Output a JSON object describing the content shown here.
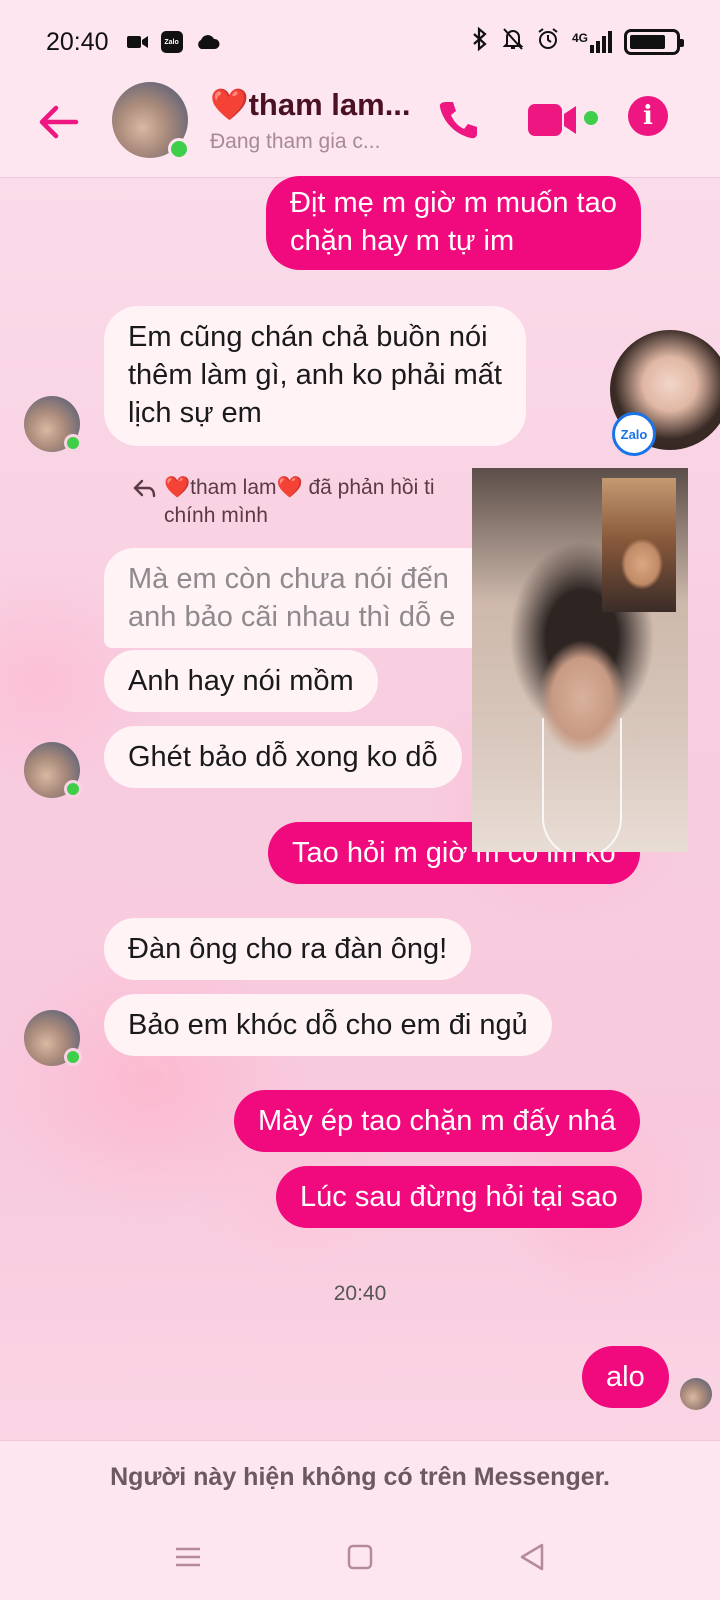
{
  "status_bar": {
    "time": "20:40",
    "left_icons": [
      "video-camera-icon",
      "zalo-icon",
      "cloud-icon"
    ],
    "right_icons": [
      "bluetooth-icon",
      "mute-bell-icon",
      "alarm-icon",
      "signal-4g-icon",
      "battery-icon"
    ],
    "network_label": "4G"
  },
  "header": {
    "contact_name": "❤️tham lam...",
    "subtitle": "Đang tham gia c...",
    "online": true,
    "call_icon": "phone-icon",
    "video_icon": "video-call-icon",
    "info_icon": "info-icon"
  },
  "messages": [
    {
      "direction": "out",
      "text": [
        "Địt mẹ m giờ m muốn tao",
        "chặn hay m tự im"
      ]
    },
    {
      "direction": "in",
      "text": [
        "Em cũng chán chả buồn nói",
        "thêm làm gì, anh ko phải mất",
        "lịch sự em"
      ]
    },
    {
      "direction": "in",
      "text": [
        "Mà em còn chưa nói đến",
        "anh bảo cãi nhau thì dỗ e"
      ],
      "faded": true
    },
    {
      "direction": "in",
      "text": [
        "Anh hay nói mồm"
      ]
    },
    {
      "direction": "in",
      "text": [
        "Ghét bảo dỗ xong ko dỗ"
      ]
    },
    {
      "direction": "out",
      "text": [
        "Tao hỏi m giờ m có im ko"
      ]
    },
    {
      "direction": "in",
      "text": [
        "Đàn ông cho ra đàn ông!"
      ]
    },
    {
      "direction": "in",
      "text": [
        "Bảo em khóc dỗ cho em đi ngủ"
      ]
    },
    {
      "direction": "out",
      "text": [
        "Mày ép tao chặn m đấy nhá"
      ]
    },
    {
      "direction": "out",
      "text": [
        "Lúc sau đừng hỏi tại sao"
      ]
    },
    {
      "direction": "out",
      "text": [
        "alo"
      ]
    }
  ],
  "reply_note": {
    "line1": "❤️tham lam❤️ đã phản hồi ti",
    "line2": "chính mình"
  },
  "timestamp": "20:40",
  "zalo_chat_head": {
    "badge": "Zalo"
  },
  "bottom": {
    "note": "Người này hiện không có trên Messenger."
  },
  "nav": [
    "menu-icon",
    "home-square-icon",
    "back-triangle-icon"
  ],
  "colors": {
    "accent": "#ee1680",
    "outgoing_bubble": "#f10a7d",
    "incoming_bubble": "#fff3f6",
    "online": "#3ecf4a"
  }
}
